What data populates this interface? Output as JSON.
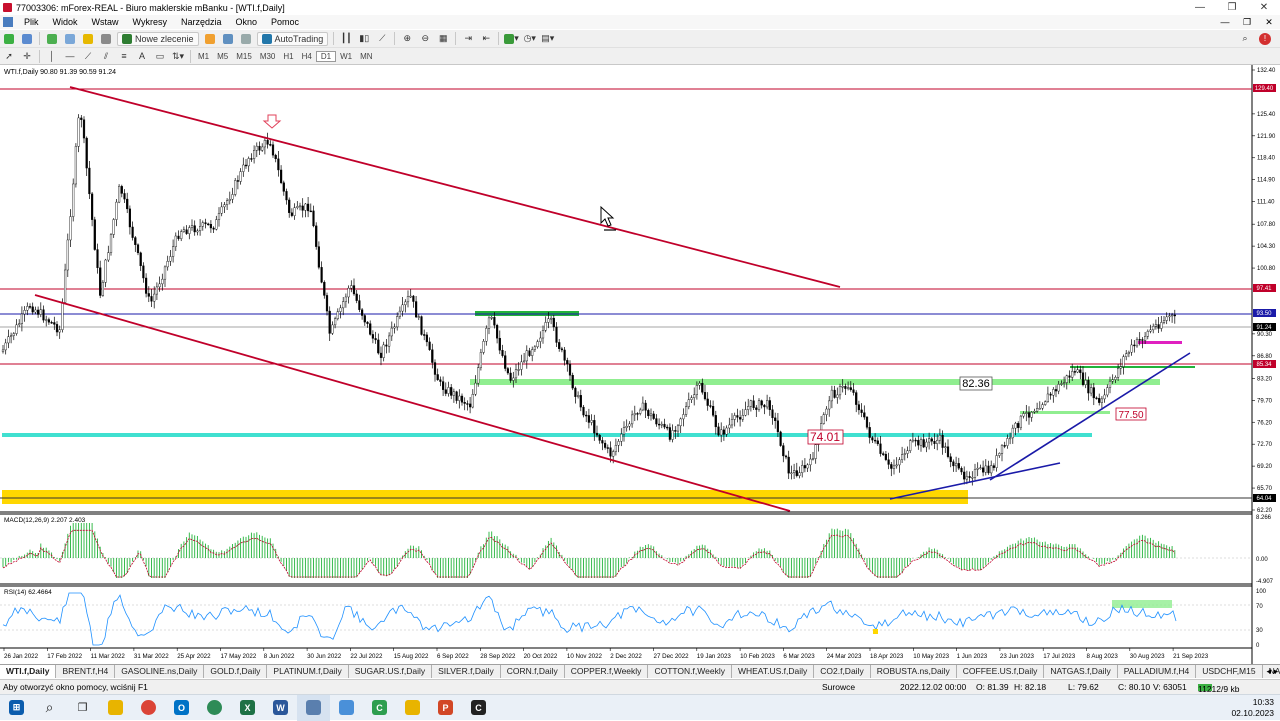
{
  "window": {
    "title": "77003306: mForex-REAL - Biuro maklerskie mBanku - [WTI.f,Daily]",
    "min": "—",
    "max": "❐",
    "close": "✕"
  },
  "menu": [
    "Plik",
    "Widok",
    "Wstaw",
    "Wykresy",
    "Narzędzia",
    "Okno",
    "Pomoc"
  ],
  "toolbar": {
    "new_order": "Nowe zlecenie",
    "autotrading": "AutoTrading",
    "timeframes": [
      "M1",
      "M5",
      "M15",
      "M30",
      "H1",
      "H4",
      "D1",
      "W1",
      "MN"
    ]
  },
  "chart": {
    "symbol_label": "WTI.f,Daily  90.80 91.39 90.59 91.24",
    "yaxis": [
      "132.40",
      "129.40",
      "125.40",
      "121.90",
      "118.40",
      "114.90",
      "111.40",
      "107.80",
      "104.30",
      "100.80",
      "97.41",
      "93.50",
      "91.24",
      "90.30",
      "86.80",
      "85.34",
      "83.20",
      "79.70",
      "76.20",
      "72.70",
      "69.20",
      "65.70",
      "64.04",
      "62.20"
    ],
    "xaxis": [
      "26 Jan 2022",
      "17 Feb 2022",
      "11 Mar 2022",
      "31 Mar 2022",
      "25 Apr 2022",
      "17 May 2022",
      "8 Jun 2022",
      "30 Jun 2022",
      "22 Jul 2022",
      "15 Aug 2022",
      "6 Sep 2022",
      "28 Sep 2022",
      "20 Oct 2022",
      "10 Nov 2022",
      "2 Dec 2022",
      "27 Dec 2022",
      "19 Jan 2023",
      "10 Feb 2023",
      "6 Mar 2023",
      "24 Mar 2023",
      "18 Apr 2023",
      "10 May 2023",
      "1 Jun 2023",
      "23 Jun 2023",
      "17 Jul 2023",
      "8 Aug 2023",
      "30 Aug 2023",
      "21 Sep 2023"
    ],
    "annotations": {
      "a1": "82.36",
      "a2": "77.50",
      "a3": "74.01"
    },
    "price_tags": {
      "p1": "129.40",
      "p2": "97.41",
      "p3": "93.50",
      "p4": "91.24",
      "p5": "85.34",
      "p6": "64.04"
    }
  },
  "macd": {
    "label": "MACD(12,26,9) 2.207 2.403",
    "axis": [
      "8.266",
      "0.00",
      "-4.907"
    ]
  },
  "rsi": {
    "label": "RSI(14) 62.4664",
    "axis": [
      "100",
      "70",
      "30",
      "0"
    ]
  },
  "tabs": [
    "WTI.f,Daily",
    "BRENT.f,H4",
    "GASOLINE.ns,Daily",
    "GOLD.f,Daily",
    "PLATINUM.f,Daily",
    "SUGAR.US.f,Daily",
    "SILVER.f,Daily",
    "CORN.f,Daily",
    "COPPER.f,Weekly",
    "COTTON.f,Weekly",
    "WHEAT.US.f,Daily",
    "CO2.f,Daily",
    "ROBUSTA.ns,Daily",
    "COFFEE.US.f,Daily",
    "NATGAS.f,Daily",
    "PALLADIUM.f,H4",
    "USDCHF,M15",
    "NATGASEU.ns,H4"
  ],
  "status": {
    "help": "Aby otworzyć okno pomocy, wciśnij F1",
    "profile": "Surowce",
    "datetime": "2022.12.02 00:00",
    "open": "O: 81.39",
    "high": "H: 82.18",
    "low": "L: 79.62",
    "close": "C: 80.10",
    "volume": "V: 63051",
    "traffic": "11212/9 kb"
  },
  "tray": {
    "time": "10:33",
    "date": "02.10.2023"
  },
  "colors": {
    "channel": "#c0002a",
    "support": "#1a1aa8",
    "green_zone": "#22b33a",
    "light_green": "#90ee90",
    "cyan_zone": "#40e0d0",
    "gold_zone": "#ffd700",
    "magenta": "#e020c0",
    "macd_hist": "#22b33a",
    "rsi_line": "#1e90ff"
  }
}
